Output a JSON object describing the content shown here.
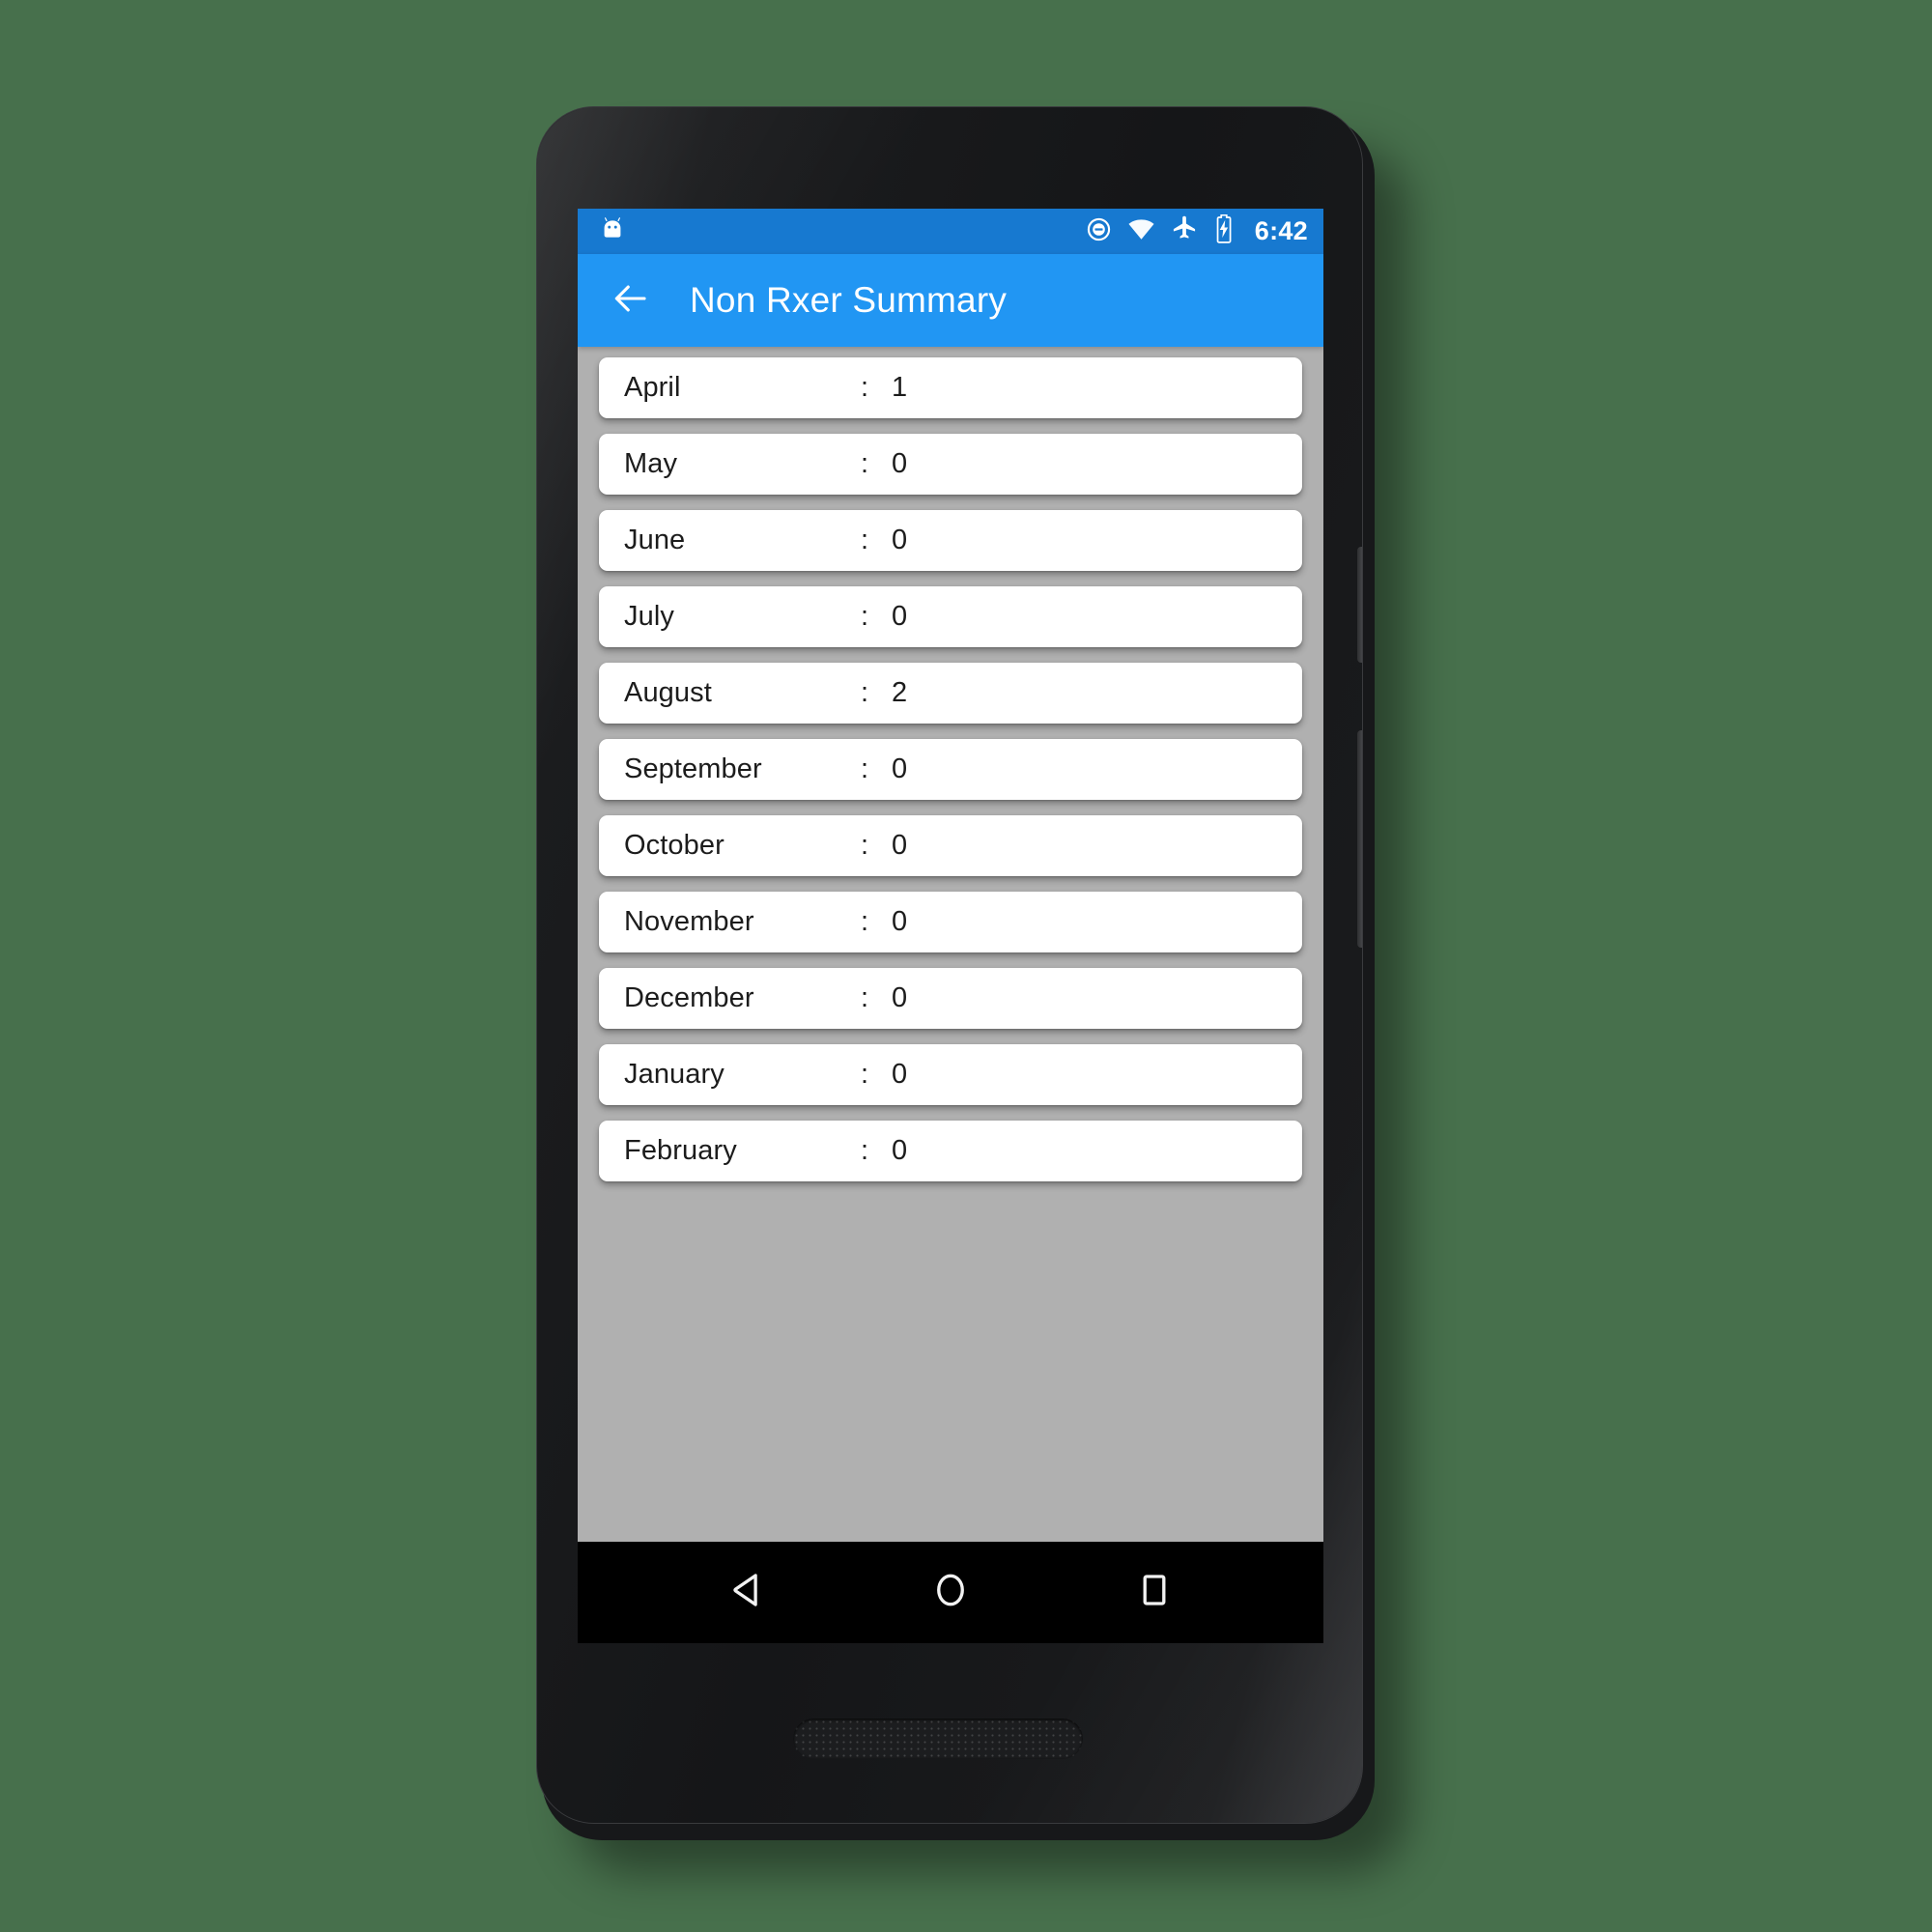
{
  "device": {
    "hardware": {
      "front_camera": "front-camera",
      "earpiece": "earpiece-speaker",
      "bottom_speaker": "bottom-speaker",
      "power_button": "power-button",
      "volume_button": "volume-button"
    }
  },
  "status_bar": {
    "notification_icon": "android-robot-icon",
    "icons": [
      "do-not-disturb-icon",
      "wifi-icon",
      "airplane-mode-icon",
      "battery-charging-icon"
    ],
    "time": "6:42",
    "background": "#1779d0"
  },
  "app_bar": {
    "back_icon": "arrow-back-icon",
    "title": "Non Rxer Summary",
    "background": "#2196f3",
    "text_color": "#ffffff"
  },
  "content": {
    "background": "#b0b0b0",
    "separator": ":",
    "card_background": "#ffffff",
    "items": [
      {
        "month": "April",
        "value": "1"
      },
      {
        "month": "May",
        "value": "0"
      },
      {
        "month": "June",
        "value": "0"
      },
      {
        "month": "July",
        "value": "0"
      },
      {
        "month": "August",
        "value": "2"
      },
      {
        "month": "September",
        "value": "0"
      },
      {
        "month": "October",
        "value": "0"
      },
      {
        "month": "November",
        "value": "0"
      },
      {
        "month": "December",
        "value": "0"
      },
      {
        "month": "January",
        "value": "0"
      },
      {
        "month": "February",
        "value": "0"
      }
    ]
  },
  "nav_bar": {
    "background": "#000000",
    "buttons": [
      {
        "name": "back-nav-button",
        "icon": "triangle-back-icon"
      },
      {
        "name": "home-nav-button",
        "icon": "circle-home-icon"
      },
      {
        "name": "recents-nav-button",
        "icon": "square-recents-icon"
      }
    ]
  },
  "page": {
    "background": "#47704c"
  }
}
